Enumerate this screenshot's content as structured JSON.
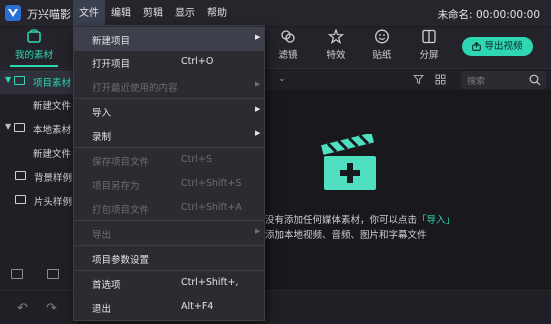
{
  "app": {
    "name": "万兴喵影",
    "document_title": "未命名: 00:00:00:00"
  },
  "menubar": [
    {
      "label": "文件",
      "active": true
    },
    {
      "label": "编辑"
    },
    {
      "label": "剪辑"
    },
    {
      "label": "显示"
    },
    {
      "label": "帮助"
    }
  ],
  "toolbar": {
    "tabs": [
      {
        "label": "我的素材",
        "icon": "media-box-icon",
        "active": true
      },
      {
        "label": "滤镜",
        "icon": "filter-icon"
      },
      {
        "label": "特效",
        "icon": "effects-icon"
      },
      {
        "label": "贴纸",
        "icon": "sticker-icon"
      },
      {
        "label": "分屏",
        "icon": "split-screen-icon"
      }
    ],
    "export_label": "导出视频"
  },
  "file_menu": {
    "items": [
      {
        "label": "新建项目",
        "shortcut": "",
        "submenu": true,
        "disabled": false,
        "hover": true
      },
      {
        "label": "打开项目",
        "shortcut": "Ctrl+O",
        "submenu": false,
        "disabled": false
      },
      {
        "label": "打开最近使用的内容",
        "shortcut": "",
        "submenu": true,
        "disabled": true
      },
      {
        "label": "导入",
        "shortcut": "",
        "submenu": true,
        "disabled": false
      },
      {
        "label": "录制",
        "shortcut": "",
        "submenu": true,
        "disabled": false
      },
      {
        "label": "保存项目文件",
        "shortcut": "Ctrl+S",
        "submenu": false,
        "disabled": true
      },
      {
        "label": "项目另存为",
        "shortcut": "Ctrl+Shift+S",
        "submenu": false,
        "disabled": true
      },
      {
        "label": "打包项目文件",
        "shortcut": "Ctrl+Shift+A",
        "submenu": false,
        "disabled": true
      },
      {
        "label": "导出",
        "shortcut": "",
        "submenu": true,
        "disabled": true
      },
      {
        "label": "项目参数设置",
        "shortcut": "",
        "submenu": false,
        "disabled": false
      },
      {
        "label": "首选项",
        "shortcut": "Ctrl+Shift+,",
        "submenu": false,
        "disabled": false
      },
      {
        "label": "退出",
        "shortcut": "Alt+F4",
        "submenu": false,
        "disabled": false
      }
    ]
  },
  "sidebar": {
    "items": [
      {
        "label": "项目素材",
        "expanded": true,
        "selected": true
      },
      {
        "label": "新建文件"
      },
      {
        "label": "本地素材",
        "expanded": true
      },
      {
        "label": "新建文件"
      },
      {
        "label": "背景样例"
      },
      {
        "label": "片头样例"
      }
    ]
  },
  "media_panel": {
    "search_placeholder": "搜索",
    "empty_line1_prefix": "没有添加任何媒体素材，你可以点击",
    "empty_line1_link": "「导入」",
    "empty_line2": "添加本地视频、音频、图片和字幕文件"
  },
  "colors": {
    "accent": "#2fd6b4",
    "background": "#1c1c22",
    "menu_bg": "#2b2b31"
  }
}
